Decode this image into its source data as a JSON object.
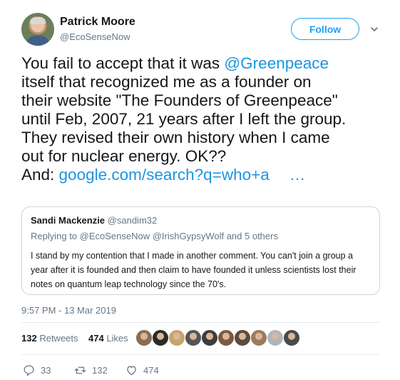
{
  "author": {
    "name": "Patrick Moore",
    "handle": "@EcoSenseNow"
  },
  "follow_label": "Follow",
  "tweet": {
    "line1_pre": "You fail to accept that it was ",
    "line1_mention": "@Greenpeace",
    "line2": "itself that recognized me as a founder on",
    "line3": "their website \"The Founders of Greenpeace\"",
    "line4": "until Feb, 2007, 21 years after I left the group.",
    "line5": "They revised their own history when I came",
    "line6": "out for nuclear energy. OK??",
    "line7_pre": "And: ",
    "line7_link": "google.com/search?q=who+a",
    "line7_ellipsis": "…"
  },
  "quote": {
    "name": "Sandi Mackenzie",
    "handle": "@sandim32",
    "replying": "Replying to @EcoSenseNow @IrishGypsyWolf and 5 others",
    "text": "I stand by my contention that I made in another comment. You can't join a group a year after it is founded and then claim to have founded it unless scientists lost their notes on quantum leap technology since the 70's."
  },
  "timestamp": "9:57 PM - 13 Mar 2019",
  "stats": {
    "retweets_count": "132",
    "retweets_label": "Retweets",
    "likes_count": "474",
    "likes_label": "Likes"
  },
  "liker_avatar_colors": [
    "#8a6d52",
    "#2b2b2b",
    "#c9a46a",
    "#555555",
    "#3d3d3d",
    "#7a5a44",
    "#5e4a3a",
    "#9b7b5f",
    "#b0b6bd",
    "#4a4a4a"
  ],
  "actions": {
    "replies": "33",
    "retweets": "132",
    "likes": "474"
  },
  "colors": {
    "accent": "#1da1f2",
    "link": "#1b95e0",
    "muted": "#657786"
  }
}
